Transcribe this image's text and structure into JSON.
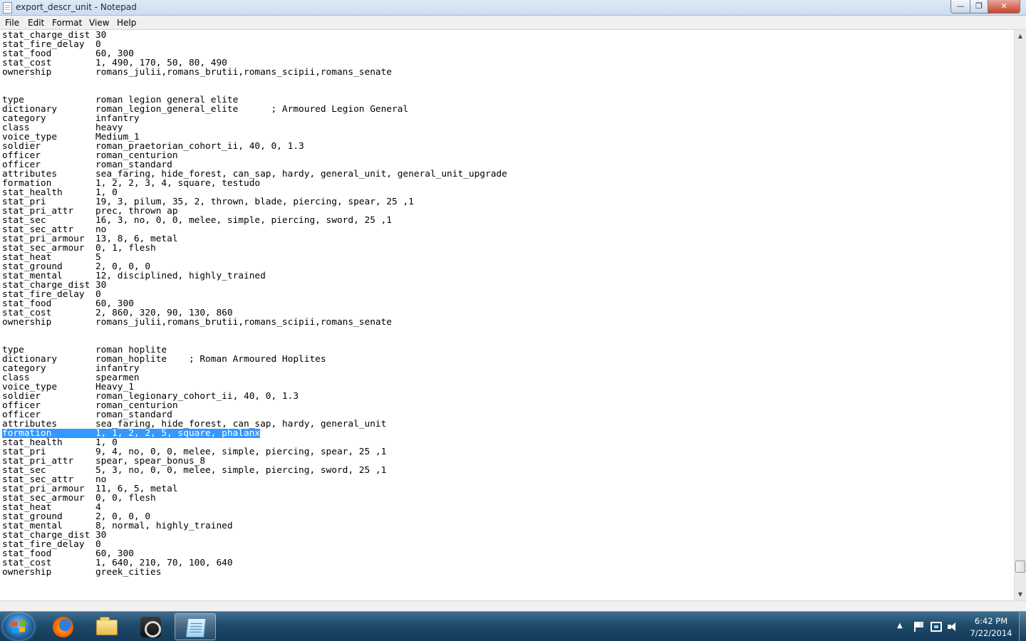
{
  "window": {
    "title": "export_descr_unit - Notepad",
    "minimize_glyph": "—",
    "maximize_glyph": "❐",
    "close_glyph": "✕"
  },
  "menu": {
    "file": "File",
    "edit": "Edit",
    "format": "Format",
    "view": "View",
    "help": "Help"
  },
  "editor": {
    "selected_line_index": 43,
    "lines": [
      "stat_charge_dist 30",
      "stat_fire_delay  0",
      "stat_food        60, 300",
      "stat_cost        1, 490, 170, 50, 80, 490",
      "ownership        romans_julii,romans_brutii,romans_scipii,romans_senate",
      "",
      "",
      "type             roman legion general elite",
      "dictionary       roman_legion_general_elite      ; Armoured Legion General",
      "category         infantry",
      "class            heavy",
      "voice_type       Medium_1",
      "soldier          roman_praetorian_cohort_ii, 40, 0, 1.3",
      "officer          roman_centurion",
      "officer          roman_standard",
      "attributes       sea_faring, hide_forest, can_sap, hardy, general_unit, general_unit_upgrade",
      "formation        1, 2, 2, 3, 4, square, testudo",
      "stat_health      1, 0",
      "stat_pri         19, 3, pilum, 35, 2, thrown, blade, piercing, spear, 25 ,1",
      "stat_pri_attr    prec, thrown ap",
      "stat_sec         16, 3, no, 0, 0, melee, simple, piercing, sword, 25 ,1",
      "stat_sec_attr    no",
      "stat_pri_armour  13, 8, 6, metal",
      "stat_sec_armour  0, 1, flesh",
      "stat_heat        5",
      "stat_ground      2, 0, 0, 0",
      "stat_mental      12, disciplined, highly_trained",
      "stat_charge_dist 30",
      "stat_fire_delay  0",
      "stat_food        60, 300",
      "stat_cost        2, 860, 320, 90, 130, 860",
      "ownership        romans_julii,romans_brutii,romans_scipii,romans_senate",
      "",
      "",
      "type             roman hoplite",
      "dictionary       roman_hoplite    ; Roman Armoured Hoplites",
      "category         infantry",
      "class            spearmen",
      "voice_type       Heavy_1",
      "soldier          roman_legionary_cohort_ii, 40, 0, 1.3",
      "officer          roman_centurion",
      "officer          roman_standard",
      "attributes       sea_faring, hide_forest, can_sap, hardy, general_unit",
      "formation        1, 1, 2, 2, 5, square, phalanx",
      "stat_health      1, 0",
      "stat_pri         9, 4, no, 0, 0, melee, simple, piercing, spear, 25 ,1",
      "stat_pri_attr    spear, spear_bonus_8",
      "stat_sec         5, 3, no, 0, 0, melee, simple, piercing, sword, 25 ,1",
      "stat_sec_attr    no",
      "stat_pri_armour  11, 6, 5, metal",
      "stat_sec_armour  0, 0, flesh",
      "stat_heat        4",
      "stat_ground      2, 0, 0, 0",
      "stat_mental      8, normal, highly_trained",
      "stat_charge_dist 30",
      "stat_fire_delay  0",
      "stat_food        60, 300",
      "stat_cost        1, 640, 210, 70, 100, 640",
      "ownership        greek_cities"
    ],
    "scroll_position": 0.97
  },
  "scrollbar": {
    "up_glyph": "▲",
    "down_glyph": "▼"
  },
  "taskbar": {
    "items": [
      {
        "name": "firefox-icon",
        "running": false
      },
      {
        "name": "windows-explorer-icon",
        "running": false
      },
      {
        "name": "steam-icon",
        "running": false
      },
      {
        "name": "notepad-icon",
        "running": true
      }
    ],
    "tray_up_glyph": "▲",
    "clock_time": "6:42 PM",
    "clock_date": "7/22/2014"
  },
  "colors": {
    "selection": "#3399ff",
    "taskbar": "#1f4a6a"
  }
}
